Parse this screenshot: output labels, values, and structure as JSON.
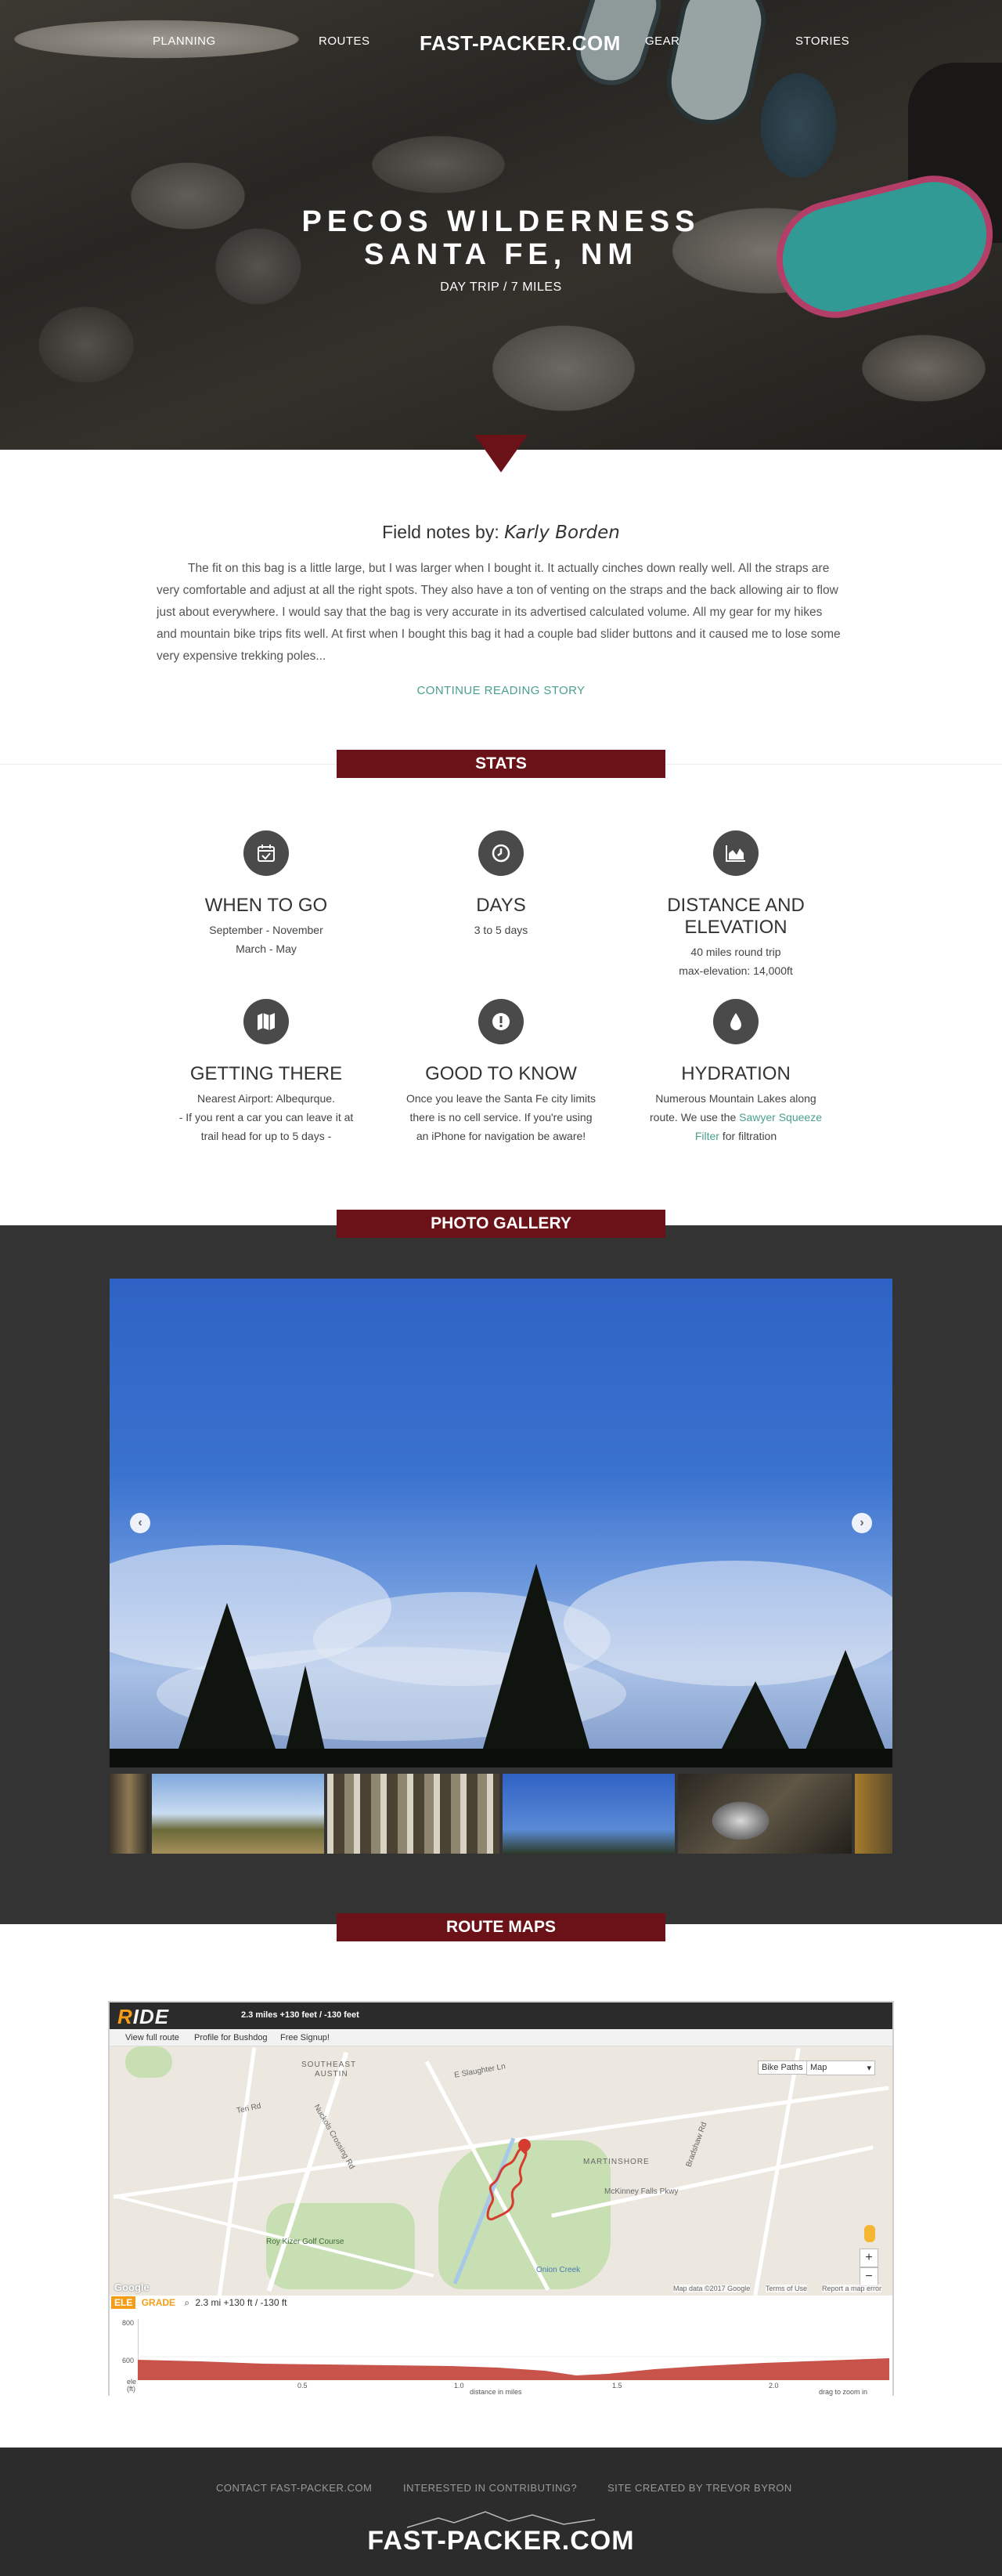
{
  "nav": {
    "planning": "PLANNING",
    "routes": "ROUTES",
    "logo": "FAST-PACKER.COM",
    "gear": "GEAR",
    "stories": "STORIES"
  },
  "hero": {
    "title_line1": "PECOS WILDERNESS",
    "title_line2": "SANTA FE, NM",
    "subtitle": "DAY TRIP / 7 MILES"
  },
  "field_notes": {
    "heading_prefix": "Field notes by:",
    "author": "Karly Borden",
    "body": "The fit on this bag is a little large, but I was larger when I bought it. It actually cinches down really well. All the straps are very comfortable and adjust at all the right spots. They also have a ton of venting on the straps and the back allowing air to flow just about everywhere. I would say that the bag is very accurate in its advertised calculated volume. All my gear for my hikes and mountain bike trips fits well. At first when I bought this bag it had a couple bad slider buttons and it caused me to lose some very expensive trekking poles...",
    "continue_link": "CONTINUE READING STORY"
  },
  "sections": {
    "stats": "STATS",
    "gallery": "PHOTO GALLERY",
    "route": "ROUTE MAPS"
  },
  "stats": [
    {
      "icon": "calendar-check-icon",
      "title": "WHEN TO GO",
      "lines": [
        "September - November",
        "March - May"
      ]
    },
    {
      "icon": "clock-icon",
      "title": "DAYS",
      "lines": [
        "3 to 5 days"
      ]
    },
    {
      "icon": "area-chart-icon",
      "title_line1": "DISTANCE AND",
      "title_line2": "ELEVATION",
      "lines": [
        "40 miles round trip",
        "max-elevation: 14,000ft"
      ]
    },
    {
      "icon": "map-icon",
      "title": "GETTING THERE",
      "lines": [
        "Nearest Airport: Albequrque.",
        "- If you rent a car you can leave it at",
        "trail head for up to 5 days -"
      ]
    },
    {
      "icon": "exclamation-icon",
      "title": "GOOD TO KNOW",
      "lines": [
        "Once you leave the Santa Fe city limits",
        "there is no cell service. If you're using",
        "an iPhone for navigation be aware!"
      ]
    },
    {
      "icon": "water-drop-icon",
      "title": "HYDRATION",
      "line1": "Numerous Mountain Lakes along",
      "line2_pre": "route. We use the ",
      "link_a": "Sawyer Squeeze",
      "link_b": "Filter",
      "line3_post": " for filtration"
    }
  ],
  "gallery": {
    "prev_icon": "‹",
    "next_icon": "›"
  },
  "route_map": {
    "brand_left": "R",
    "brand_right": "IDE",
    "summary": "2.3 miles +130 feet / -130 feet",
    "links": [
      "View full route",
      "Profile for Bushdog",
      "Free Signup!"
    ],
    "map_labels": [
      "SOUTHEAST",
      "AUSTIN",
      "MARTINSHORE",
      "Roy Kizer Golf Course",
      "McKinney Falls Pkwy",
      "Teri Rd",
      "Nuckols Crossing Rd",
      "E Slaughter Ln",
      "Onion Creek",
      "Bradshaw Rd"
    ],
    "bike_paths_btn": "Bike Paths",
    "map_type": "Map",
    "zoom_in": "+",
    "zoom_out": "−",
    "attribution": [
      "Map data ©2017 Google",
      "Terms of Use",
      "Report a map error"
    ],
    "google": "Google",
    "ele_tag": "ELE",
    "grade_tag": "GRADE",
    "elev_summary": "2.3 mi +130 ft / -130 ft",
    "y_ticks": [
      "800",
      "600"
    ],
    "x_ticks": [
      "0.5",
      "1.0",
      "1.5",
      "2.0"
    ],
    "y_unit": "ele (ft)",
    "x_label": "distance in miles",
    "drag_hint": "drag to zoom in"
  },
  "footer": {
    "contact": "CONTACT FAST-PACKER.COM",
    "contribute": "INTERESTED IN CONTRIBUTING?",
    "credit": "SITE CREATED BY TREVOR BYRON",
    "logo": "FAST-PACKER.COM"
  },
  "colors": {
    "accent": "#6b1118",
    "link": "#4aa08e",
    "gallery_bg": "#333333",
    "footer_bg": "#2c2c2c",
    "elevation_fill": "#c8534b"
  }
}
